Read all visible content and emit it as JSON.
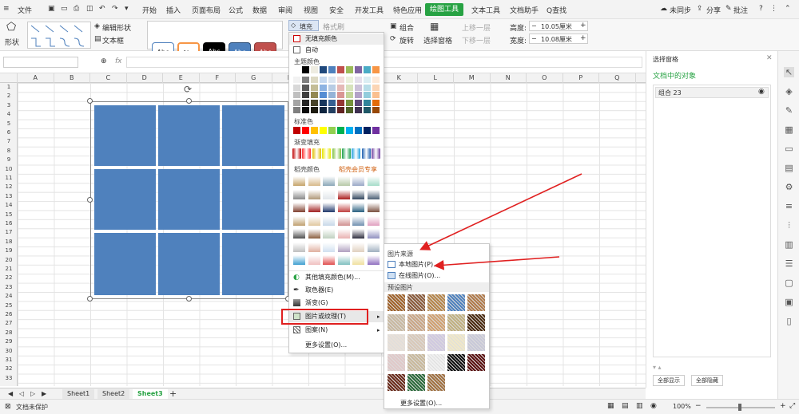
{
  "menubar": {
    "file": "文件",
    "tabs": [
      "开始",
      "插入",
      "页面布局",
      "公式",
      "数据",
      "审阅",
      "视图",
      "安全",
      "开发工具",
      "特色应用",
      "绘图工具",
      "文本工具",
      "文档助手"
    ],
    "search": "Q查找",
    "sync": "未同步",
    "share": "分享",
    "comment": "批注"
  },
  "ribbon": {
    "shape": "形状",
    "edit_shape": "编辑形状",
    "textbox": "文本框",
    "style_samples": [
      "Abc",
      "Abc",
      "Abc",
      "Abc",
      "Abc"
    ],
    "fill": "填充",
    "format_painter": "格式刷",
    "group": "组合",
    "rotate": "旋转",
    "selection_pane": "选择窗格",
    "bring_forward": "上移一层",
    "send_backward": "下移一层",
    "height_label": "高度:",
    "height_value": "10.05厘米",
    "width_label": "宽度:",
    "width_value": "10.08厘米"
  },
  "formula": {
    "fx": "fx"
  },
  "columns": [
    "A",
    "B",
    "C",
    "D",
    "E",
    "F",
    "G",
    "H",
    "I",
    "J",
    "K",
    "L",
    "M",
    "N",
    "O",
    "P",
    "Q"
  ],
  "rows": [
    "1",
    "2",
    "3",
    "4",
    "5",
    "6",
    "7",
    "8",
    "9",
    "10",
    "11",
    "12",
    "13",
    "14",
    "15",
    "16",
    "17",
    "18",
    "19",
    "20",
    "21",
    "22",
    "23",
    "24",
    "25",
    "26",
    "27",
    "28",
    "29",
    "30",
    "31",
    "32",
    "33"
  ],
  "sheets": [
    "Sheet1",
    "Sheet2",
    "Sheet3"
  ],
  "status": {
    "protect": "文档未保护",
    "zoom": "100%"
  },
  "pane": {
    "title": "选择窗格",
    "heading": "文档中的对象",
    "item": "组合 23",
    "show_all": "全部显示",
    "hide_all": "全部隐藏"
  },
  "fill_menu": {
    "no_fill": "无填充颜色",
    "auto": "自动",
    "theme_colors": "主题颜色",
    "standard_colors": "标准色",
    "gradient_fill": "渐变填充",
    "texture_colors": "稻壳颜色",
    "member_exclusive": "稻壳会员专享",
    "more_fill": "其他填充颜色(M)...",
    "eyedropper": "取色器(E)",
    "gradient": "渐变(G)",
    "picture_texture": "图片或纹理(T)",
    "pattern": "图案(N)",
    "more_settings": "更多设置(O)..."
  },
  "submenu": {
    "source": "图片来源",
    "local": "本地图片(P)...",
    "online": "在线图片(O)...",
    "preset": "预设图片",
    "more": "更多设置(O)..."
  },
  "colors": {
    "accent": "#27a243",
    "shape_fill": "#4f81bd",
    "arrow": "#e02020"
  }
}
